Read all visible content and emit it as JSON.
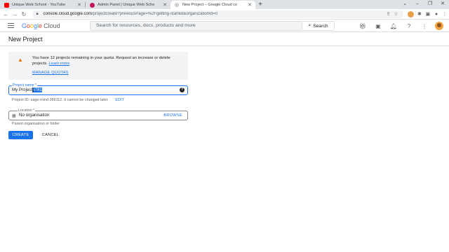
{
  "browser": {
    "tabs": [
      {
        "title": "Unique Web School - YouTube",
        "favicon_color": "#ff0000",
        "active": false
      },
      {
        "title": "Admin Panel | Unique Web Scho",
        "favicon_color": "#c2185b",
        "active": false
      },
      {
        "title": "New Project – Google Cloud co",
        "favicon_color": "#5f6368",
        "active": true
      }
    ],
    "new_tab": "+",
    "url_host": "console.cloud.google.com",
    "url_path": "/projectcreate?previousPage=%2Fgetting-started&organizationId=0"
  },
  "header": {
    "logo_letters": [
      "G",
      "o",
      "o",
      "g",
      "l",
      "e"
    ],
    "logo_product": "Cloud",
    "search_placeholder": "Search for resources, docs, products and more",
    "search_button": "Search"
  },
  "page": {
    "title": "New Project"
  },
  "notice": {
    "message": "You have 12 projects remaining in your quota. Request an increase or delete projects.",
    "learn_more": "Learn more",
    "manage_quotas": "MANAGE QUOTAS"
  },
  "project_name": {
    "label": "Project name *",
    "value_prefix": "My Project",
    "value_selected": "6781",
    "project_id_text": "Project ID: sage-mind-366112. It cannot be changed later.",
    "edit_label": "EDIT"
  },
  "location": {
    "label": "Location *",
    "value": "No organisation",
    "browse_label": "BROWSE",
    "help": "Parent organisation or folder"
  },
  "actions": {
    "create": "CREATE",
    "cancel": "CANCEL"
  },
  "colors": {
    "accent": "#1a73e8",
    "warning": "#e37400"
  }
}
